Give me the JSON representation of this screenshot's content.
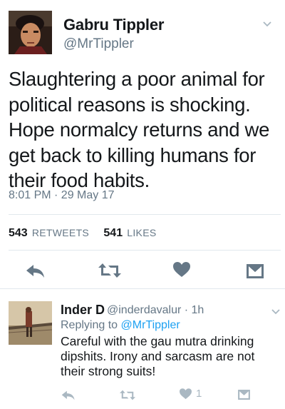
{
  "main_tweet": {
    "display_name": "Gabru Tippler",
    "handle": "@MrTippler",
    "text": "Slaughtering a poor animal for political reasons is shocking. Hope normalcy returns and we get back to killing humans for their food habits.",
    "timestamp": "8:01 PM · 29 May 17",
    "retweets_count": "543",
    "retweets_label": "RETWEETS",
    "likes_count": "541",
    "likes_label": "LIKES",
    "icons": [
      "reply-icon",
      "retweet-icon",
      "like-icon",
      "direct-message-icon"
    ]
  },
  "reply_tweet": {
    "display_name": "Inder D",
    "handle": "@inderdavalur · 1h",
    "replying_prefix": "Replying to",
    "replying_to": "@MrTippler",
    "text": "Careful with the gau mutra drinking dipshits. Irony and sarcasm are not their strong suits!",
    "like_count": "1",
    "icons": [
      "reply-icon",
      "retweet-icon",
      "like-icon",
      "direct-message-icon"
    ]
  },
  "colors": {
    "text": "#14171a",
    "secondary": "#657786",
    "link": "#1da1f2",
    "divider": "#e1e8ed",
    "muted_icon": "#aab8c2"
  }
}
